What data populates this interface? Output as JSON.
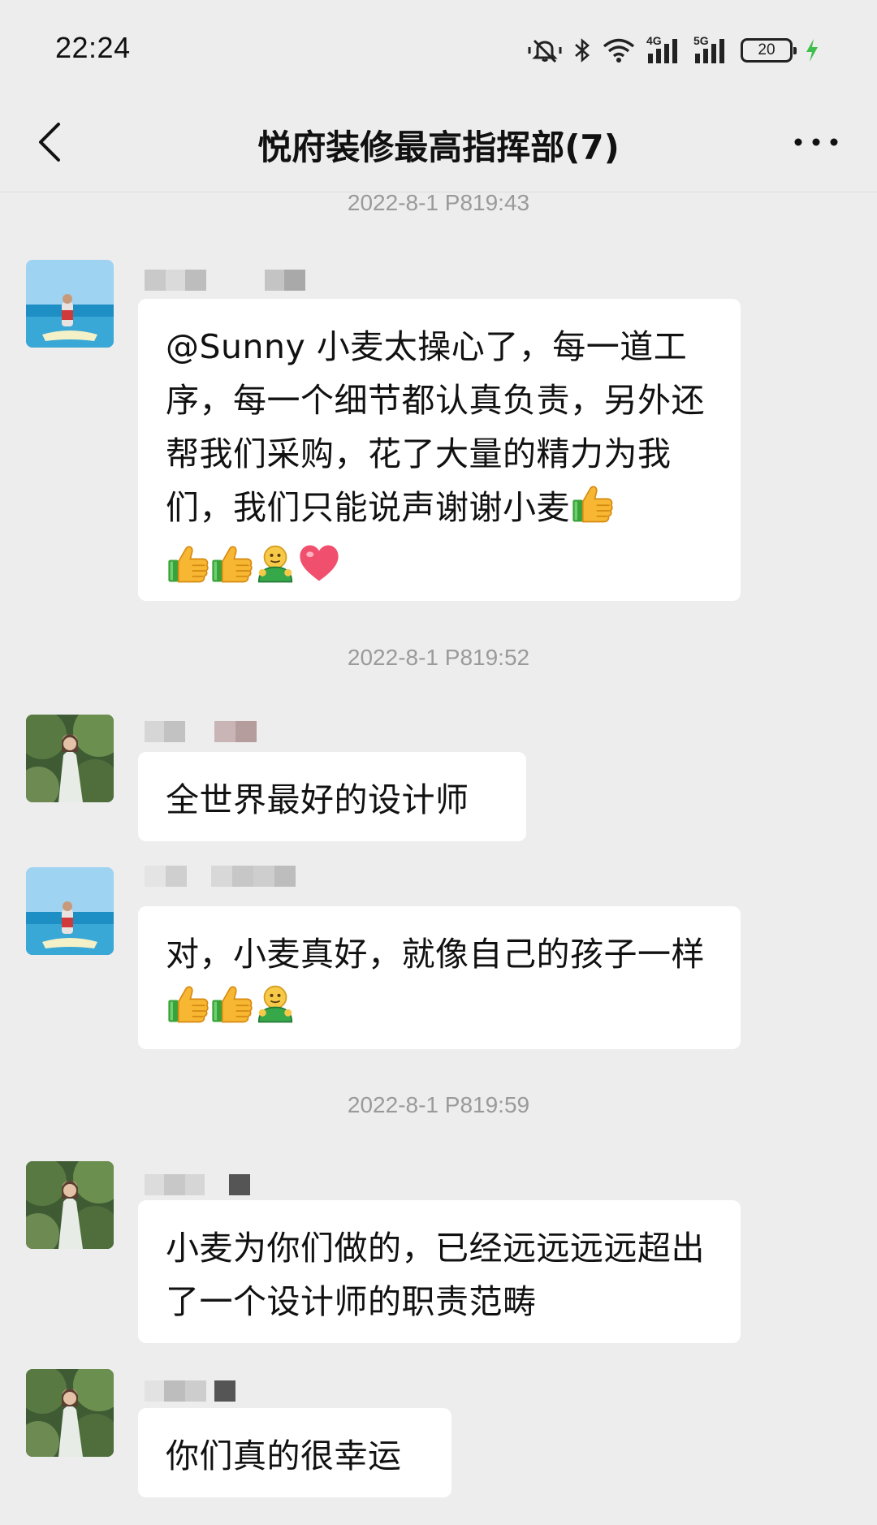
{
  "status": {
    "time": "22:24",
    "signal_4g_label": "4G",
    "signal_5g_label": "5G",
    "battery": "20"
  },
  "header": {
    "title": "悦府装修最高指挥部(7)"
  },
  "messages": [
    {
      "timestamp": "2022-8-1 P819:43",
      "text": "@Sunny 小麦太操心了，每一道工序，每一个细节都认真负责，另外还帮我们采购，花了大量的精力为我们，我们只能说声谢谢小麦",
      "avatar": "jetski-sea-avatar",
      "emojis": [
        "thumbs-up",
        "thumbs-up",
        "thumbs-up",
        "hug",
        "red-heart"
      ]
    },
    {
      "timestamp": "2022-8-1 P819:52",
      "text": "全世界最好的设计师",
      "avatar": "forest-woman-avatar"
    },
    {
      "text": "对，小麦真好，就像自己的孩子一样",
      "avatar": "jetski-sea-avatar",
      "emojis": [
        "thumbs-up",
        "thumbs-up",
        "hug"
      ]
    },
    {
      "timestamp": "2022-8-1 P819:59",
      "text": "小麦为你们做的，已经远远远远超出了一个设计师的职责范畴",
      "avatar": "forest-woman-avatar"
    },
    {
      "text": "你们真的很幸运",
      "avatar": "forest-woman-avatar"
    }
  ],
  "colors": {
    "background": "#ededed",
    "bubble": "#ffffff",
    "timestamp": "#9a9a9a",
    "charging": "#3cc04b"
  }
}
